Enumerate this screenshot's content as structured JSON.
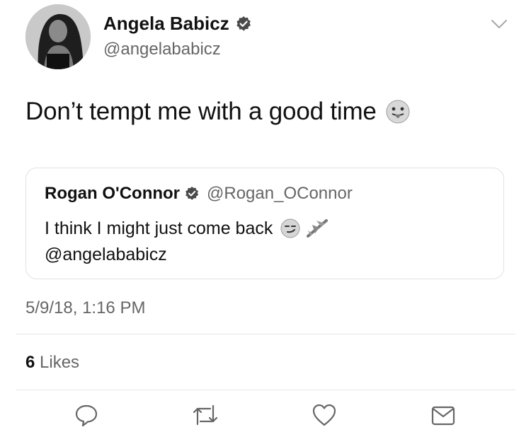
{
  "author": {
    "name": "Angela Babicz",
    "handle": "@angelababicz",
    "verified": true
  },
  "tweet": {
    "text": "Don’t tempt me with a good time",
    "emoji": "tongue-face"
  },
  "quoted_tweet": {
    "name": "Rogan O'Connor",
    "handle": "@Rogan_OConnor",
    "verified": true,
    "line1": "I think I might just come back",
    "line1_emojis": [
      "smirk-face",
      "airplane"
    ],
    "line2": "@angelababicz"
  },
  "meta": {
    "timestamp": "5/9/18, 1:16 PM",
    "likes_count": "6",
    "likes_label": "Likes"
  },
  "actions": [
    {
      "name": "reply-icon"
    },
    {
      "name": "retweet-icon"
    },
    {
      "name": "like-icon"
    },
    {
      "name": "message-icon"
    }
  ],
  "colors": {
    "text": "#111111",
    "secondary": "#666666",
    "border": "#e1e1e1"
  }
}
